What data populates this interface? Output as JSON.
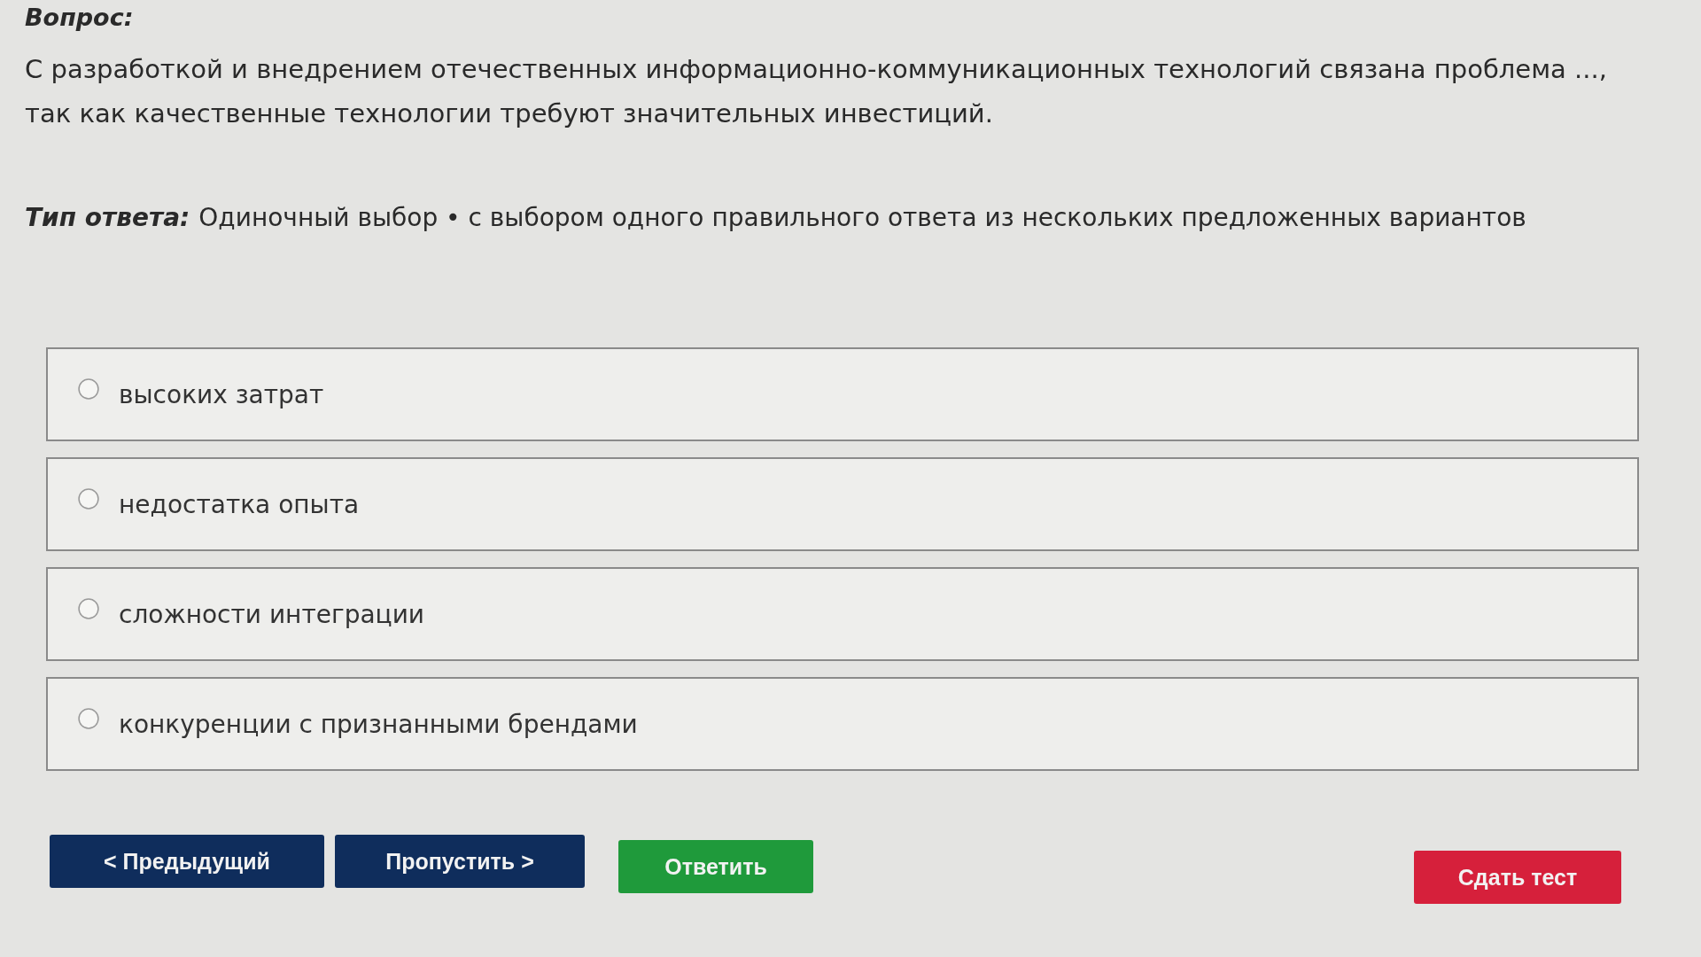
{
  "question": {
    "label": "Вопрос:",
    "text": "С разработкой и внедрением отечественных информационно-коммуникационных технологий связана проблема ..., так как качественные технологии требуют значительных инвестиций."
  },
  "answer_type": {
    "label": "Тип ответа:",
    "value": "Одиночный выбор • с выбором одного правильного ответа из нескольких предложенных вариантов"
  },
  "options": [
    {
      "label": "высоких затрат",
      "selected": false
    },
    {
      "label": "недостатка опыта",
      "selected": false
    },
    {
      "label": "сложности интеграции",
      "selected": false
    },
    {
      "label": "конкуренции с признанными брендами",
      "selected": false
    }
  ],
  "buttons": [
    {
      "kind": "prev",
      "label": "< Предыдущий"
    },
    {
      "kind": "skip",
      "label": "Пропустить >"
    },
    {
      "kind": "answer",
      "label": "Ответить"
    },
    {
      "kind": "submit",
      "label": "Сдать тест"
    }
  ]
}
